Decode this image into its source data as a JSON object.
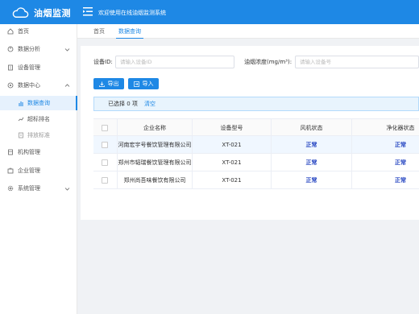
{
  "header": {
    "title": "油烟监测",
    "welcome": "欢迎使用在线油烟监测系统"
  },
  "sidebar": {
    "items": [
      {
        "label": "首页",
        "icon": "home-icon"
      },
      {
        "label": "数据分析",
        "icon": "chart-icon"
      },
      {
        "label": "设备管理",
        "icon": "device-icon"
      },
      {
        "label": "数据中心",
        "icon": "data-center-icon"
      },
      {
        "label": "数据查询",
        "icon": "bar-chart-icon"
      },
      {
        "label": "超标排名",
        "icon": "trend-icon"
      },
      {
        "label": "排放标准",
        "icon": "document-icon"
      },
      {
        "label": "机构管理",
        "icon": "building-icon"
      },
      {
        "label": "企业管理",
        "icon": "enterprise-icon"
      },
      {
        "label": "系统管理",
        "icon": "settings-icon"
      }
    ]
  },
  "tabs": [
    {
      "label": "首页"
    },
    {
      "label": "数据查询"
    }
  ],
  "form": {
    "device_label": "设备ID:",
    "device_placeholder": "请输入设备ID",
    "concentration_label": "油烟浓度(mg/m³):",
    "concentration_placeholder": "请输入设备号"
  },
  "buttons": {
    "export": "导出",
    "import": "导入"
  },
  "selection": {
    "text": "已选择 0 项",
    "clear": "清空"
  },
  "table": {
    "columns": [
      "企业名称",
      "设备型号",
      "风机状态",
      "净化器状态"
    ],
    "rows": [
      {
        "company": "河南宏宇号餐饮管理有限公司",
        "model": "XT-021",
        "fan": "正常",
        "purifier": "正常"
      },
      {
        "company": "郑州市韬瑞餐饮管理有限公司",
        "model": "XT-021",
        "fan": "正常",
        "purifier": "正常"
      },
      {
        "company": "郑州尚吾味餐饮有限公司",
        "model": "XT-021",
        "fan": "正常",
        "purifier": "正常"
      }
    ]
  },
  "colors": {
    "primary": "#1e88e5",
    "status": "#1e3fbf"
  }
}
